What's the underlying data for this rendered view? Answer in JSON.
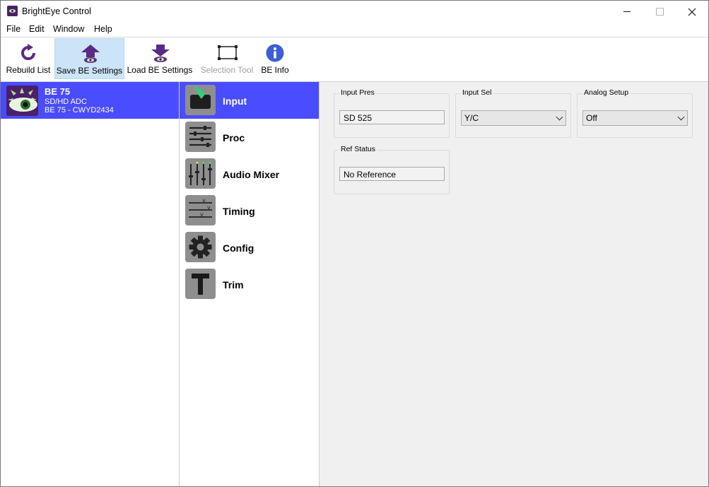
{
  "window": {
    "title": "BrightEye Control"
  },
  "menu": [
    "File",
    "Edit",
    "Window",
    "Help"
  ],
  "toolbar": {
    "rebuild": "Rebuild List",
    "save": "Save BE Settings",
    "load": "Load BE Settings",
    "selection": "Selection Tool",
    "info": "BE Info"
  },
  "device": {
    "name": "BE 75",
    "type": "SD/HD ADC",
    "serial": "BE 75 - CWYD2434"
  },
  "categories": [
    "Input",
    "Proc",
    "Audio Mixer",
    "Timing",
    "Config",
    "Trim"
  ],
  "panel": {
    "input_pres": {
      "label": "Input Pres",
      "value": "SD 525"
    },
    "input_sel": {
      "label": "Input Sel",
      "value": "Y/C"
    },
    "analog_setup": {
      "label": "Analog Setup",
      "value": "Off"
    },
    "ref_status": {
      "label": "Ref Status",
      "value": "No Reference"
    }
  },
  "colors": {
    "selection": "#4a4cff",
    "toolbar_active": "#cce4f7",
    "logo": "#4a1f6b"
  }
}
